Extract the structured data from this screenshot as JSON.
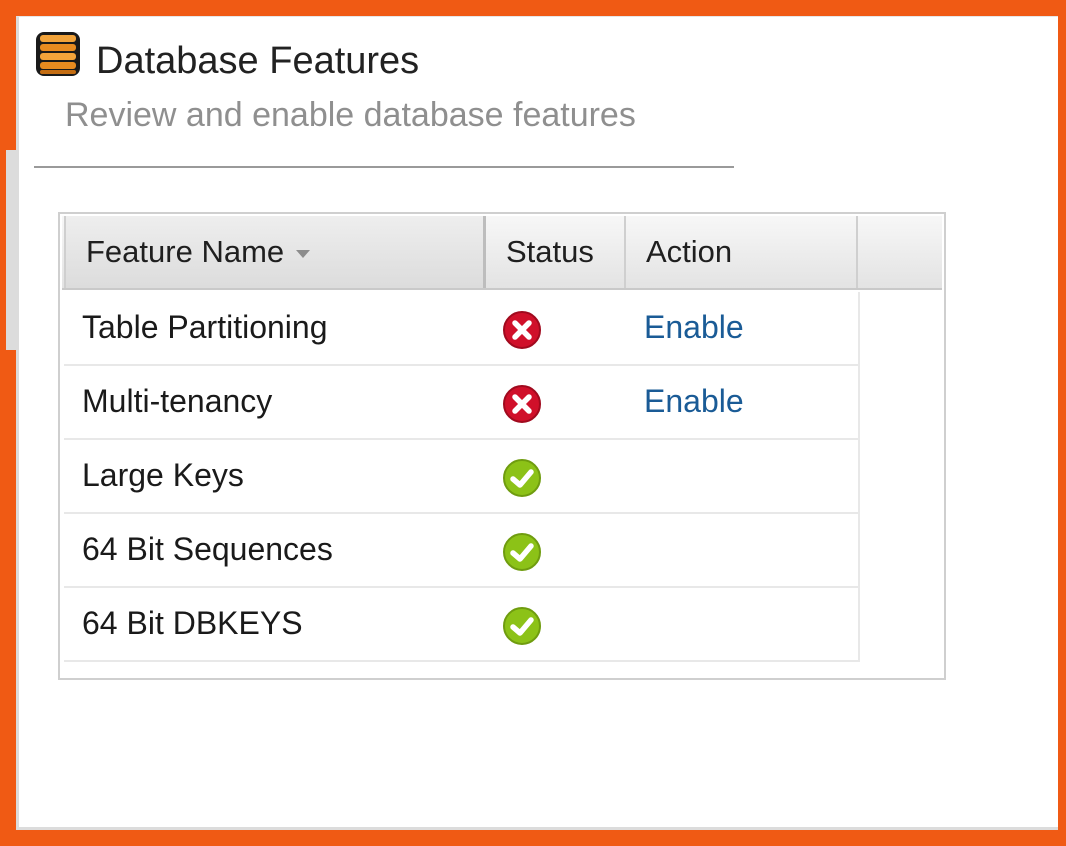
{
  "header": {
    "title": "Database Features",
    "subtitle": "Review and enable database features",
    "icon": "database-icon"
  },
  "table": {
    "columns": {
      "name": "Feature Name",
      "status": "Status",
      "action": "Action"
    },
    "rows": [
      {
        "name": "Table Partitioning",
        "status": "disabled",
        "action": "Enable"
      },
      {
        "name": "Multi-tenancy",
        "status": "disabled",
        "action": "Enable"
      },
      {
        "name": "Large Keys",
        "status": "enabled",
        "action": ""
      },
      {
        "name": "64 Bit Sequences",
        "status": "enabled",
        "action": ""
      },
      {
        "name": "64 Bit DBKEYS",
        "status": "enabled",
        "action": ""
      }
    ]
  },
  "colors": {
    "frame": "#f05a14",
    "link": "#1a5b96",
    "status_disabled": "#d0102a",
    "status_enabled": "#8cc217"
  }
}
